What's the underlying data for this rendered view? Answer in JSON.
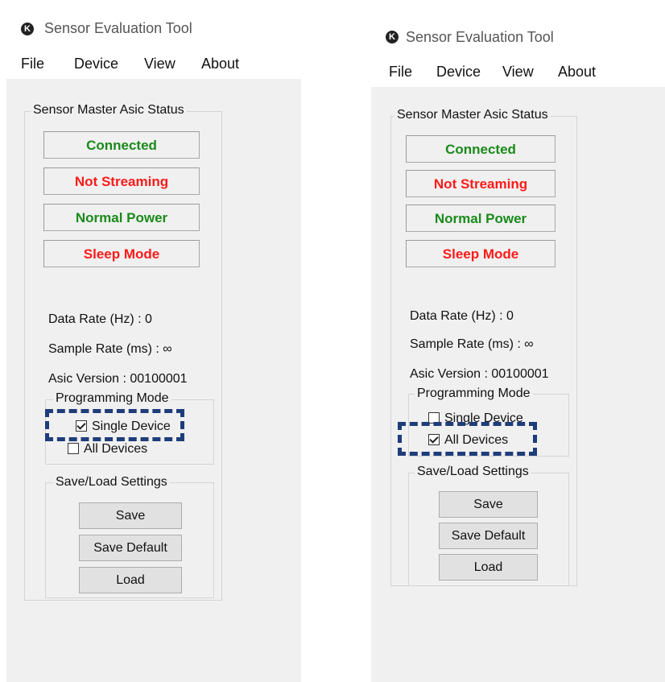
{
  "left_window": {
    "title": "Sensor Evaluation Tool",
    "menu": [
      "File",
      "Device",
      "View",
      "About"
    ],
    "status_group_label": "Sensor Master Asic Status",
    "statuses": [
      {
        "label": "Connected",
        "color": "#1a8a1a"
      },
      {
        "label": "Not Streaming",
        "color": "#ff1a1a"
      },
      {
        "label": "Normal Power",
        "color": "#1a8a1a"
      },
      {
        "label": "Sleep Mode",
        "color": "#ff1a1a"
      }
    ],
    "data_rate": "Data Rate (Hz) : 0",
    "sample_rate": "Sample Rate (ms) : ∞",
    "asic_version": "Asic Version : 00100001",
    "programming_mode_label": "Programming Mode",
    "single_device": {
      "label": "Single Device",
      "checked": true
    },
    "all_devices": {
      "label": "All Devices",
      "checked": false
    },
    "save_load_label": "Save/Load Settings",
    "buttons": {
      "save": "Save",
      "save_default": "Save Default",
      "load": "Load"
    }
  },
  "right_window": {
    "title": "Sensor Evaluation Tool",
    "menu": [
      "File",
      "Device",
      "View",
      "About"
    ],
    "status_group_label": "Sensor Master Asic Status",
    "statuses": [
      {
        "label": "Connected",
        "color": "#1a8a1a"
      },
      {
        "label": "Not Streaming",
        "color": "#ff1a1a"
      },
      {
        "label": "Normal Power",
        "color": "#1a8a1a"
      },
      {
        "label": "Sleep Mode",
        "color": "#ff1a1a"
      }
    ],
    "data_rate": "Data Rate (Hz) : 0",
    "sample_rate": "Sample Rate (ms) : ∞",
    "asic_version": "Asic Version : 00100001",
    "programming_mode_label": "Programming Mode",
    "single_device": {
      "label": "Single Device",
      "checked": false
    },
    "all_devices": {
      "label": "All Devices",
      "checked": true
    },
    "save_load_label": "Save/Load Settings",
    "buttons": {
      "save": "Save",
      "save_default": "Save Default",
      "load": "Load"
    }
  },
  "highlight_color": "#1f3d7a",
  "icons": {
    "app_icon": "app-logo-icon",
    "checkbox_checked": "checkmark-icon"
  }
}
